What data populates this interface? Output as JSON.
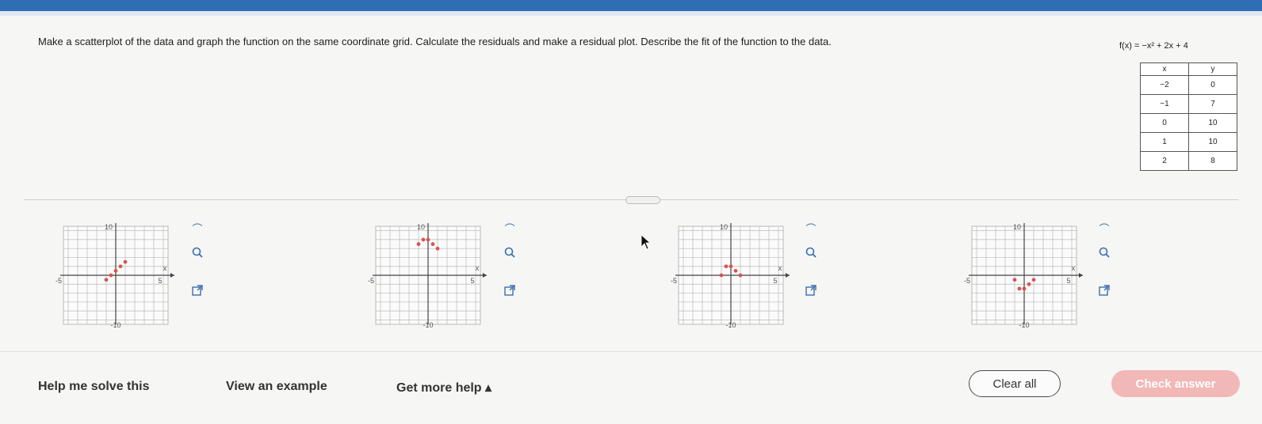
{
  "question": {
    "prompt": "Make a scatterplot of the data and graph the function on the same coordinate grid. Calculate the residuals and make a residual plot. Describe the fit of the function to the data.",
    "function_label": "f(x) = −x² + 2x + 4",
    "table": {
      "headers": [
        "x",
        "y"
      ],
      "rows": [
        [
          "−2",
          "0"
        ],
        [
          "−1",
          "7"
        ],
        [
          "0",
          "10"
        ],
        [
          "1",
          "10"
        ],
        [
          "2",
          "8"
        ]
      ]
    }
  },
  "graphs": [
    {
      "id": "A",
      "y_top_label": "10",
      "y_bottom_label": "-10",
      "x_left_label": "-5",
      "x_right_label": "5",
      "x_axis_label": "x",
      "points": [
        [
          -2,
          -1
        ],
        [
          -1,
          0
        ],
        [
          0,
          1
        ],
        [
          1,
          2
        ],
        [
          2,
          3
        ]
      ]
    },
    {
      "id": "B",
      "y_top_label": "10",
      "y_bottom_label": "-10",
      "x_left_label": "-5",
      "x_right_label": "5",
      "x_axis_label": "x",
      "points": [
        [
          -2,
          7
        ],
        [
          -1,
          8
        ],
        [
          0,
          8
        ],
        [
          1,
          7
        ],
        [
          2,
          6
        ]
      ]
    },
    {
      "id": "C",
      "y_top_label": "10",
      "y_bottom_label": "-10",
      "x_left_label": "-5",
      "x_right_label": "5",
      "x_axis_label": "x",
      "points": [
        [
          -2,
          0
        ],
        [
          -1,
          2
        ],
        [
          0,
          2
        ],
        [
          1,
          1
        ],
        [
          2,
          0
        ]
      ]
    },
    {
      "id": "D",
      "y_top_label": "10",
      "y_bottom_label": "-10",
      "x_left_label": "-5",
      "x_right_label": "5",
      "x_axis_label": "x",
      "points": [
        [
          -2,
          -1
        ],
        [
          -1,
          -3
        ],
        [
          0,
          -3
        ],
        [
          1,
          -2
        ],
        [
          2,
          -1
        ]
      ]
    }
  ],
  "graph_style": {
    "point_color": "#d9534f",
    "grid_color": "#b9b9b9",
    "axis_color": "#444444"
  },
  "footer": {
    "help": "Help me solve this",
    "example": "View an example",
    "more_help": "Get more help ▴",
    "clear": "Clear all",
    "check": "Check answer"
  },
  "colors": {
    "accent": "#2f6db5",
    "check_button": "#f2b7b7"
  }
}
